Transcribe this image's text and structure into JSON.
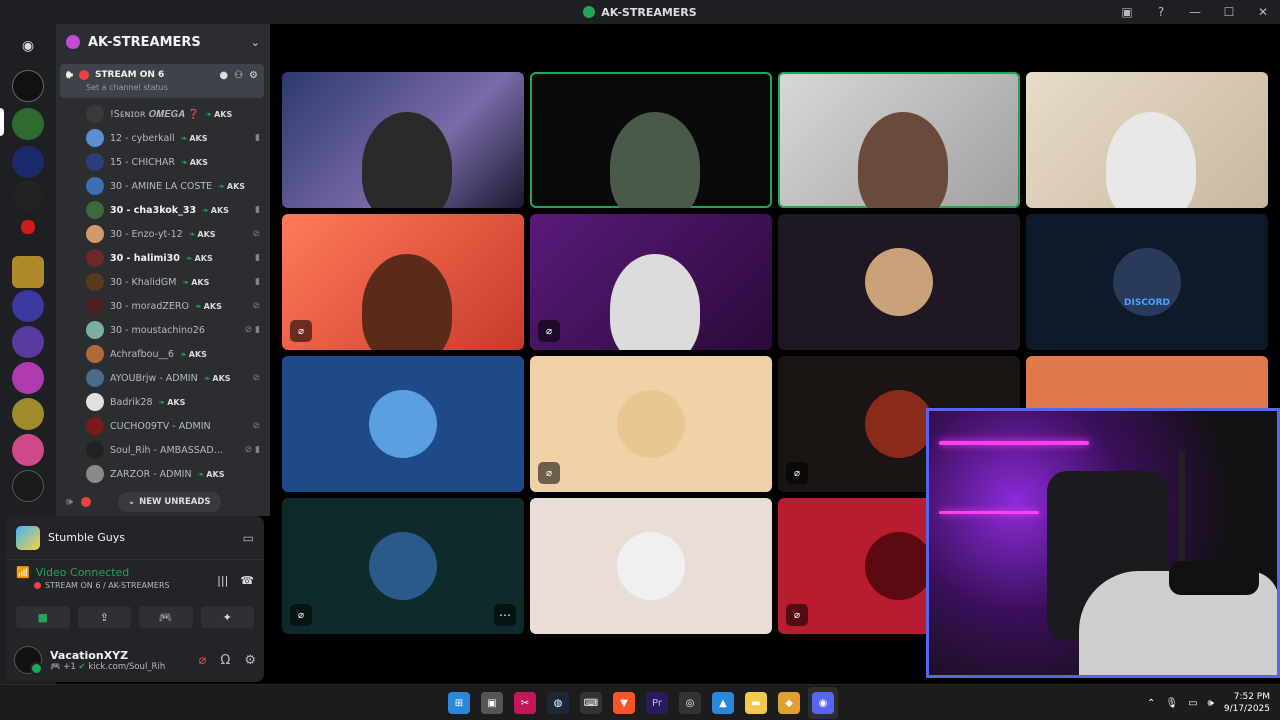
{
  "window": {
    "title": "AK-STREAMERS",
    "minimize": "—",
    "maximize": "☐",
    "close": "✕"
  },
  "server": {
    "name": "AK-STREAMERS",
    "active_channel": "STREAM ON 6",
    "channel_status_placeholder": "Set a channel status",
    "members": [
      {
        "name": "!Sᴇɴɪᴏʀ 𝑶𝑴𝑬𝑮𝑨 ❓",
        "tag": "AKS",
        "bright": false,
        "status": "",
        "color": "#3a3a3a"
      },
      {
        "name": "12 - cyberkall",
        "tag": "AKS",
        "bright": false,
        "status": "▮",
        "color": "#5b8fd1"
      },
      {
        "name": "15 - CHICHAR",
        "tag": "AKS",
        "bright": false,
        "status": "",
        "color": "#2b3f7a"
      },
      {
        "name": "30 - AMINE LA COSTE",
        "tag": "AKS",
        "bright": false,
        "status": "",
        "color": "#3d6fb5"
      },
      {
        "name": "30 - cha3kok_33",
        "tag": "AKS",
        "bright": true,
        "status": "▮",
        "color": "#3a6b3a"
      },
      {
        "name": "30 - Enzo-yt-12",
        "tag": "AKS",
        "bright": false,
        "status": "⊘",
        "color": "#d19a6b"
      },
      {
        "name": "30 - halimi30",
        "tag": "AKS",
        "bright": true,
        "status": "▮",
        "color": "#6b2a2a"
      },
      {
        "name": "30 - KhalidGM",
        "tag": "AKS",
        "bright": false,
        "status": "▮",
        "color": "#5a3a1a"
      },
      {
        "name": "30 - moradZERO",
        "tag": "AKS",
        "bright": false,
        "status": "⊘",
        "color": "#4a2020"
      },
      {
        "name": "30 - moustachino26",
        "tag": "",
        "bright": false,
        "status": "⊘ ▮",
        "color": "#7ab0a0"
      },
      {
        "name": "Achrafbou__6",
        "tag": "AKS",
        "bright": false,
        "status": "",
        "color": "#b06a3a"
      },
      {
        "name": "AYOUBrjw - ADMIN",
        "tag": "AKS",
        "bright": false,
        "status": "⊘",
        "color": "#4a6a8a"
      },
      {
        "name": "Badrik28",
        "tag": "AKS",
        "bright": false,
        "status": "",
        "color": "#e0e0e0"
      },
      {
        "name": "CUCHO09TV - ADMIN",
        "tag": "",
        "bright": false,
        "status": "⊘",
        "color": "#7a1a1a"
      },
      {
        "name": "Soul_Rih - AMBASSAD...",
        "tag": "",
        "bright": false,
        "status": "⊘ ▮",
        "color": "#222"
      },
      {
        "name": "ZARZOR - ADMIN",
        "tag": "AKS",
        "bright": false,
        "status": "",
        "color": "#8a8a8a"
      }
    ],
    "new_unreads": "NEW UNREADS"
  },
  "activity": {
    "game": "Stumble Guys"
  },
  "voice": {
    "status": "Video Connected",
    "location": "STREAM ON 6 / AK-STREAMERS"
  },
  "user": {
    "name": "VacationXYZ",
    "badge": "+1",
    "status": "kick.com/Soul_Rih"
  },
  "tiles": [
    {
      "label": "",
      "muted": false
    },
    {
      "label": "",
      "muted": false
    },
    {
      "label": "",
      "muted": false
    },
    {
      "label": "",
      "muted": false
    },
    {
      "label": "",
      "muted": true
    },
    {
      "label": "",
      "muted": true
    },
    {
      "label": "",
      "muted": false
    },
    {
      "label": "DISCORD",
      "muted": false
    },
    {
      "label": "",
      "muted": false
    },
    {
      "label": "",
      "muted": true
    },
    {
      "label": "",
      "muted": true
    },
    {
      "label": "",
      "muted": false
    },
    {
      "label": "",
      "muted": true
    },
    {
      "label": "",
      "muted": false
    },
    {
      "label": "",
      "muted": true
    }
  ],
  "taskbar": {
    "time": "7:52 PM",
    "date": "9/17/2025"
  },
  "colors": {
    "accent": "#5865f2",
    "speaking": "#23a559",
    "live": "#ed4245"
  }
}
